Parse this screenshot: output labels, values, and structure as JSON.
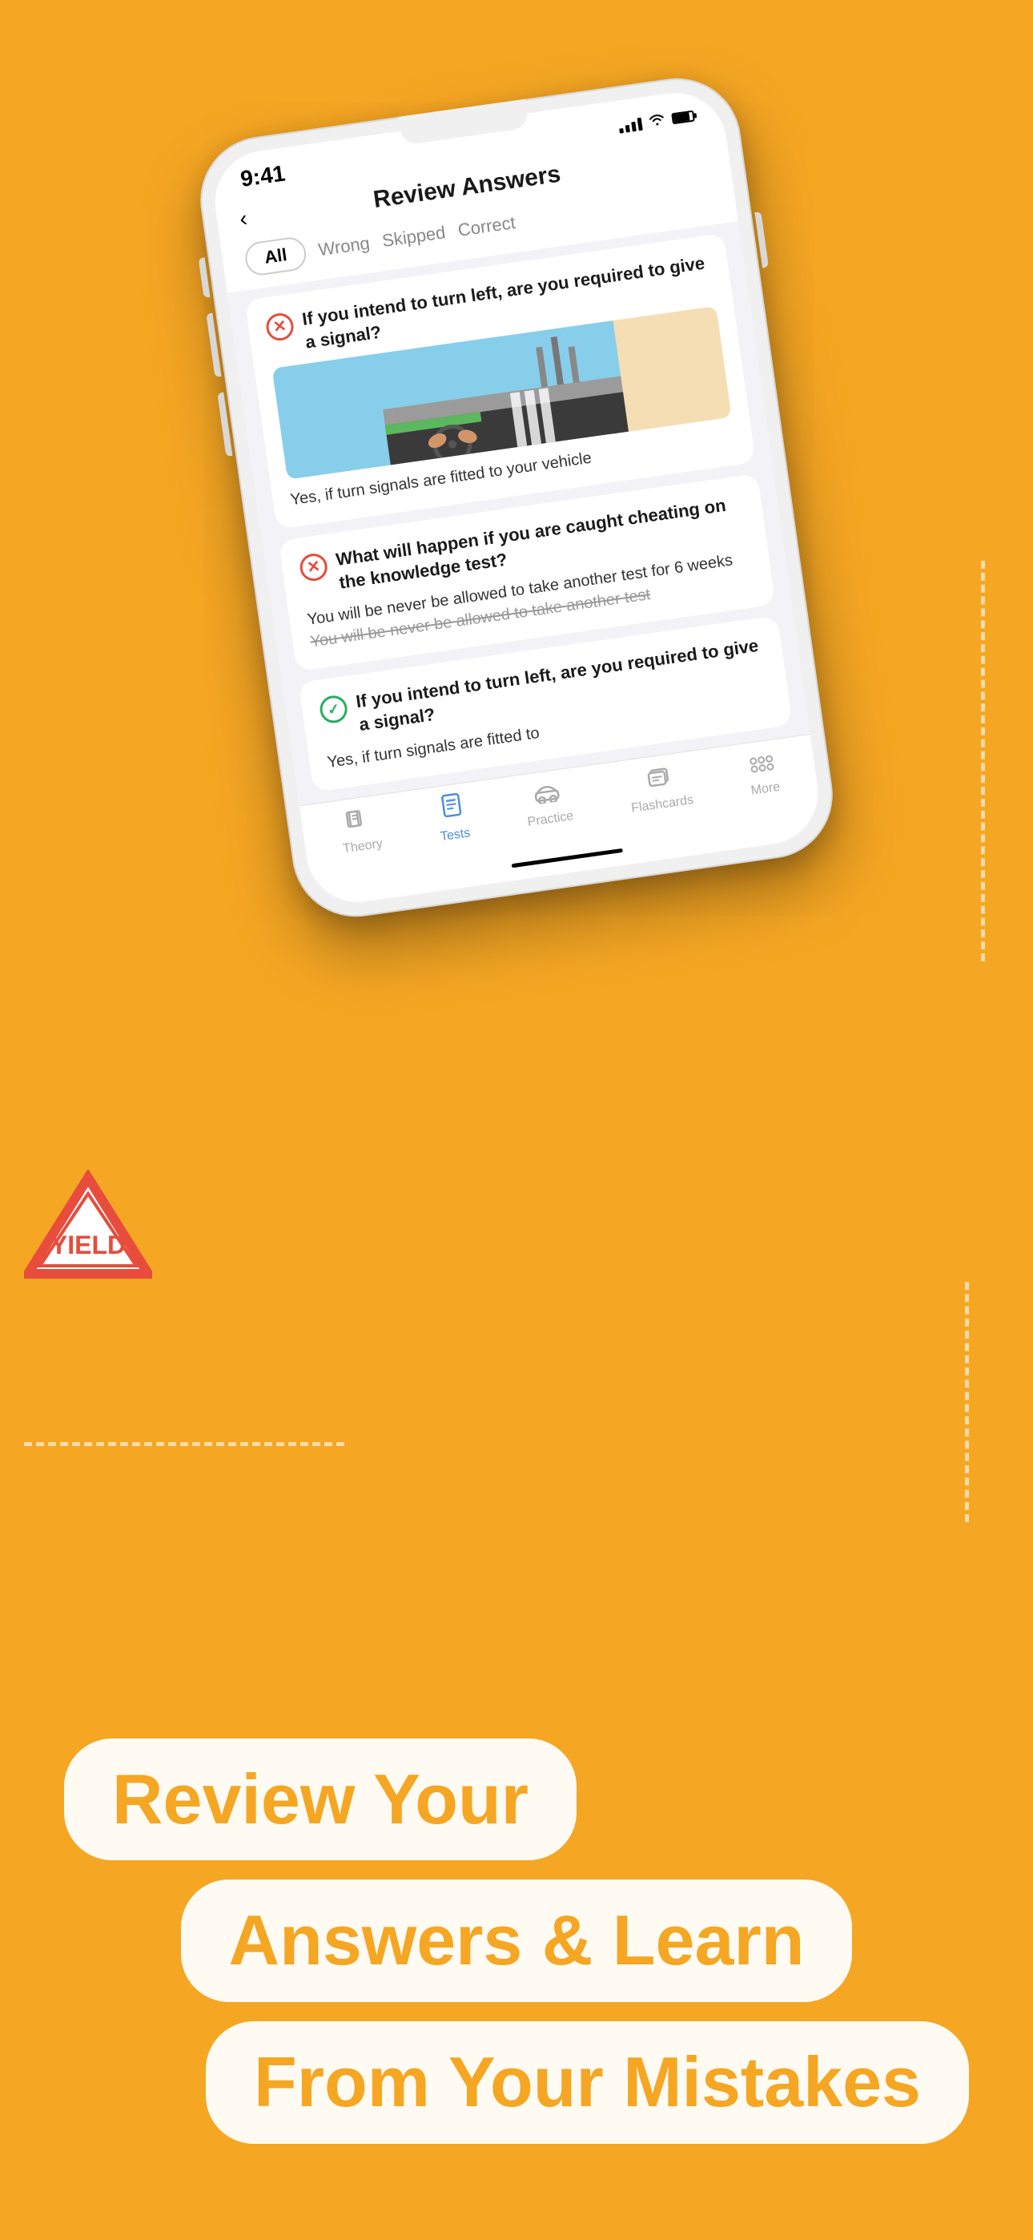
{
  "background_color": "#F5A623",
  "status_bar": {
    "time": "9:41",
    "signal": "●●●●",
    "battery": "85%"
  },
  "header": {
    "title": "Review Answers",
    "back_label": "‹"
  },
  "filter_tabs": [
    {
      "label": "All",
      "active": true
    },
    {
      "label": "Wrong",
      "active": false
    },
    {
      "label": "Skipped",
      "active": false
    },
    {
      "label": "Correct",
      "active": false
    }
  ],
  "questions": [
    {
      "id": 1,
      "status": "wrong",
      "question": "If you intend to turn left,  are you required to give a signal?",
      "has_image": true,
      "answer": "Yes, if turn signals are fitted to your vehicle",
      "strikethrough": null
    },
    {
      "id": 2,
      "status": "wrong",
      "question": "What will happen if you are caught cheating on the knowledge test?",
      "has_image": false,
      "answer": "You will be never be allowed to take another test for 6 weeks",
      "strikethrough": "You will be never be allowed to take another test"
    },
    {
      "id": 3,
      "status": "correct",
      "question": "If you intend to turn left,  are you required to give a signal?",
      "has_image": false,
      "answer": "Yes, if turn signals are fitted to",
      "strikethrough": null
    }
  ],
  "bottom_nav": [
    {
      "label": "Theory",
      "icon": "📚",
      "active": false
    },
    {
      "label": "Tests",
      "icon": "📋",
      "active": true
    },
    {
      "label": "Practice",
      "icon": "🚗",
      "active": false
    },
    {
      "label": "Flashcards",
      "icon": "🃏",
      "active": false
    },
    {
      "label": "More",
      "icon": "⋯",
      "active": false
    }
  ],
  "bottom_text": {
    "line1": "Review Your",
    "line2": "Answers & Learn",
    "line3": "From Your Mistakes"
  }
}
